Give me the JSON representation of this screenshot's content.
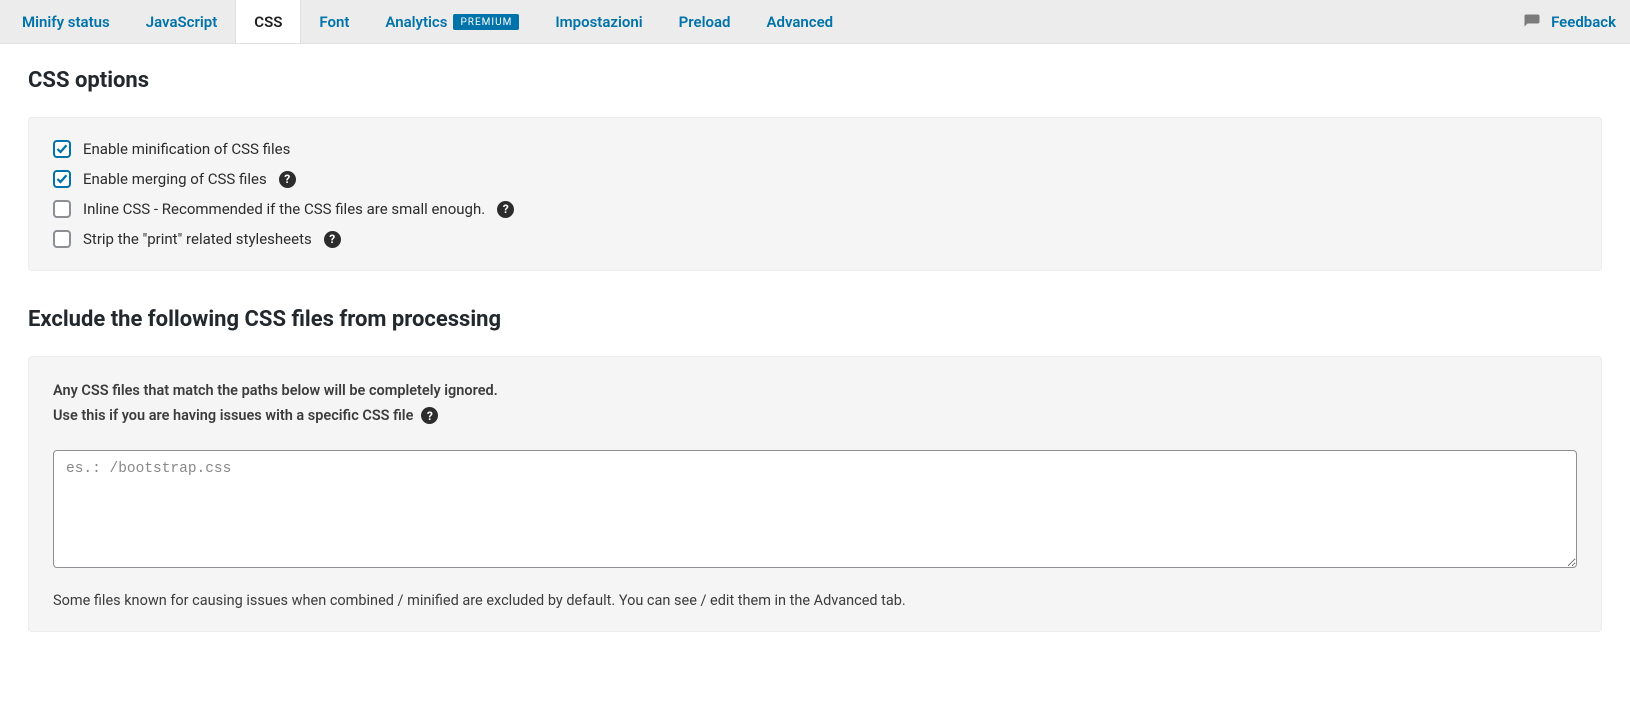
{
  "tabs": {
    "minify_status": "Minify status",
    "javascript": "JavaScript",
    "css": "CSS",
    "font": "Font",
    "analytics": "Analytics",
    "analytics_badge": "PREMIUM",
    "impostazioni": "Impostazioni",
    "preload": "Preload",
    "advanced": "Advanced"
  },
  "feedback_label": "Feedback",
  "sections": {
    "css_options": {
      "heading": "CSS options",
      "options": {
        "enable_minification": {
          "label": "Enable minification of CSS files",
          "checked": true,
          "has_help": false
        },
        "enable_merging": {
          "label": "Enable merging of CSS files",
          "checked": true,
          "has_help": true
        },
        "inline_css": {
          "label": "Inline CSS - Recommended if the CSS files are small enough.",
          "checked": false,
          "has_help": true
        },
        "strip_print": {
          "label": "Strip the \"print\" related stylesheets",
          "checked": false,
          "has_help": true
        }
      }
    },
    "exclude": {
      "heading": "Exclude the following CSS files from processing",
      "intro_line1": "Any CSS files that match the paths below will be completely ignored.",
      "intro_line2": "Use this if you are having issues with a specific CSS file",
      "textarea_placeholder": "es.: /bootstrap.css",
      "textarea_value": "",
      "note": "Some files known for causing issues when combined / minified are excluded by default. You can see / edit them in the Advanced tab."
    }
  }
}
